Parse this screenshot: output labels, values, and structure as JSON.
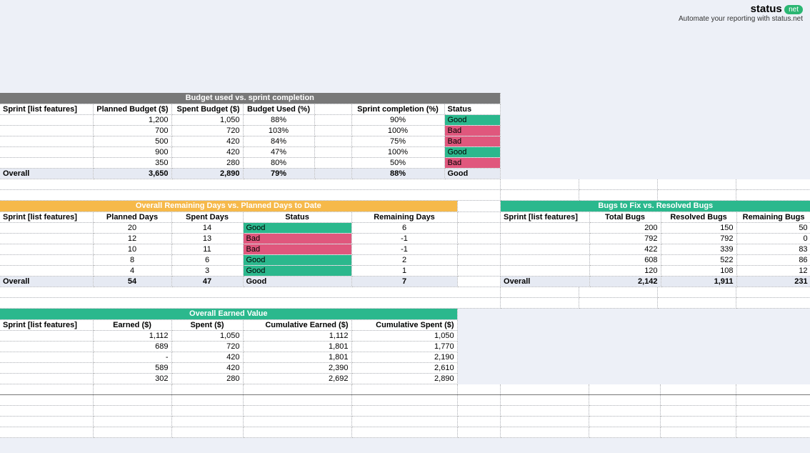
{
  "brand": {
    "name": "status",
    "badge": "net",
    "tagline": "Automate your reporting with status.net"
  },
  "budget": {
    "title": "Budget used vs. sprint completion",
    "cols": [
      "Sprint [list features]",
      "Planned Budget ($)",
      "Spent Budget ($)",
      "Budget Used (%)",
      "Sprint completion (%)",
      "Status"
    ],
    "rows": [
      {
        "sprint": "",
        "planned": "1,200",
        "spent": "1,050",
        "used": "88%",
        "comp": "90%",
        "status": "Good",
        "cls": "good"
      },
      {
        "sprint": "",
        "planned": "700",
        "spent": "720",
        "used": "103%",
        "comp": "100%",
        "status": "Bad",
        "cls": "bad"
      },
      {
        "sprint": "",
        "planned": "500",
        "spent": "420",
        "used": "84%",
        "comp": "75%",
        "status": "Bad",
        "cls": "bad"
      },
      {
        "sprint": "",
        "planned": "900",
        "spent": "420",
        "used": "47%",
        "comp": "100%",
        "status": "Good",
        "cls": "good"
      },
      {
        "sprint": "",
        "planned": "350",
        "spent": "280",
        "used": "80%",
        "comp": "50%",
        "status": "Bad",
        "cls": "bad"
      }
    ],
    "overall": {
      "label": "Overall",
      "planned": "3,650",
      "spent": "2,890",
      "used": "79%",
      "comp": "88%",
      "status": "Good",
      "cls": "good"
    }
  },
  "days": {
    "title": "Overall Remaining Days vs. Planned Days to Date",
    "cols": [
      "Sprint [list features]",
      "Planned Days",
      "Spent Days",
      "Status",
      "Remaining Days"
    ],
    "rows": [
      {
        "sprint": "",
        "planned": "20",
        "spent": "14",
        "status": "Good",
        "cls": "good",
        "remain": "6"
      },
      {
        "sprint": "",
        "planned": "12",
        "spent": "13",
        "status": "Bad",
        "cls": "bad",
        "remain": "-1"
      },
      {
        "sprint": "",
        "planned": "10",
        "spent": "11",
        "status": "Bad",
        "cls": "bad",
        "remain": "-1"
      },
      {
        "sprint": "",
        "planned": "8",
        "spent": "6",
        "status": "Good",
        "cls": "good",
        "remain": "2"
      },
      {
        "sprint": "",
        "planned": "4",
        "spent": "3",
        "status": "Good",
        "cls": "good",
        "remain": "1"
      }
    ],
    "overall": {
      "label": "Overall",
      "planned": "54",
      "spent": "47",
      "status": "Good",
      "cls": "good",
      "remain": "7"
    }
  },
  "bugs": {
    "title": "Bugs to Fix vs. Resolved Bugs",
    "cols": [
      "Sprint [list features]",
      "Total Bugs",
      "Resolved Bugs",
      "Remaining Bugs"
    ],
    "rows": [
      {
        "sprint": "",
        "total": "200",
        "resolved": "150",
        "remain": "50"
      },
      {
        "sprint": "",
        "total": "792",
        "resolved": "792",
        "remain": "0"
      },
      {
        "sprint": "",
        "total": "422",
        "resolved": "339",
        "remain": "83"
      },
      {
        "sprint": "",
        "total": "608",
        "resolved": "522",
        "remain": "86"
      },
      {
        "sprint": "",
        "total": "120",
        "resolved": "108",
        "remain": "12"
      }
    ],
    "overall": {
      "label": "Overall",
      "total": "2,142",
      "resolved": "1,911",
      "remain": "231"
    }
  },
  "earned": {
    "title": "Overall Earned Value",
    "cols": [
      "Sprint [list features]",
      "Earned ($)",
      "Spent ($)",
      "Cumulative Earned ($)",
      "Cumulative Spent ($)"
    ],
    "rows": [
      {
        "sprint": "",
        "earned": "1,112",
        "spent": "1,050",
        "cearned": "1,112",
        "cspent": "1,050"
      },
      {
        "sprint": "",
        "earned": "689",
        "spent": "720",
        "cearned": "1,801",
        "cspent": "1,770"
      },
      {
        "sprint": "",
        "earned": "-",
        "spent": "420",
        "cearned": "1,801",
        "cspent": "2,190"
      },
      {
        "sprint": "",
        "earned": "589",
        "spent": "420",
        "cearned": "2,390",
        "cspent": "2,610"
      },
      {
        "sprint": "",
        "earned": "302",
        "spent": "280",
        "cearned": "2,692",
        "cspent": "2,890"
      }
    ]
  }
}
